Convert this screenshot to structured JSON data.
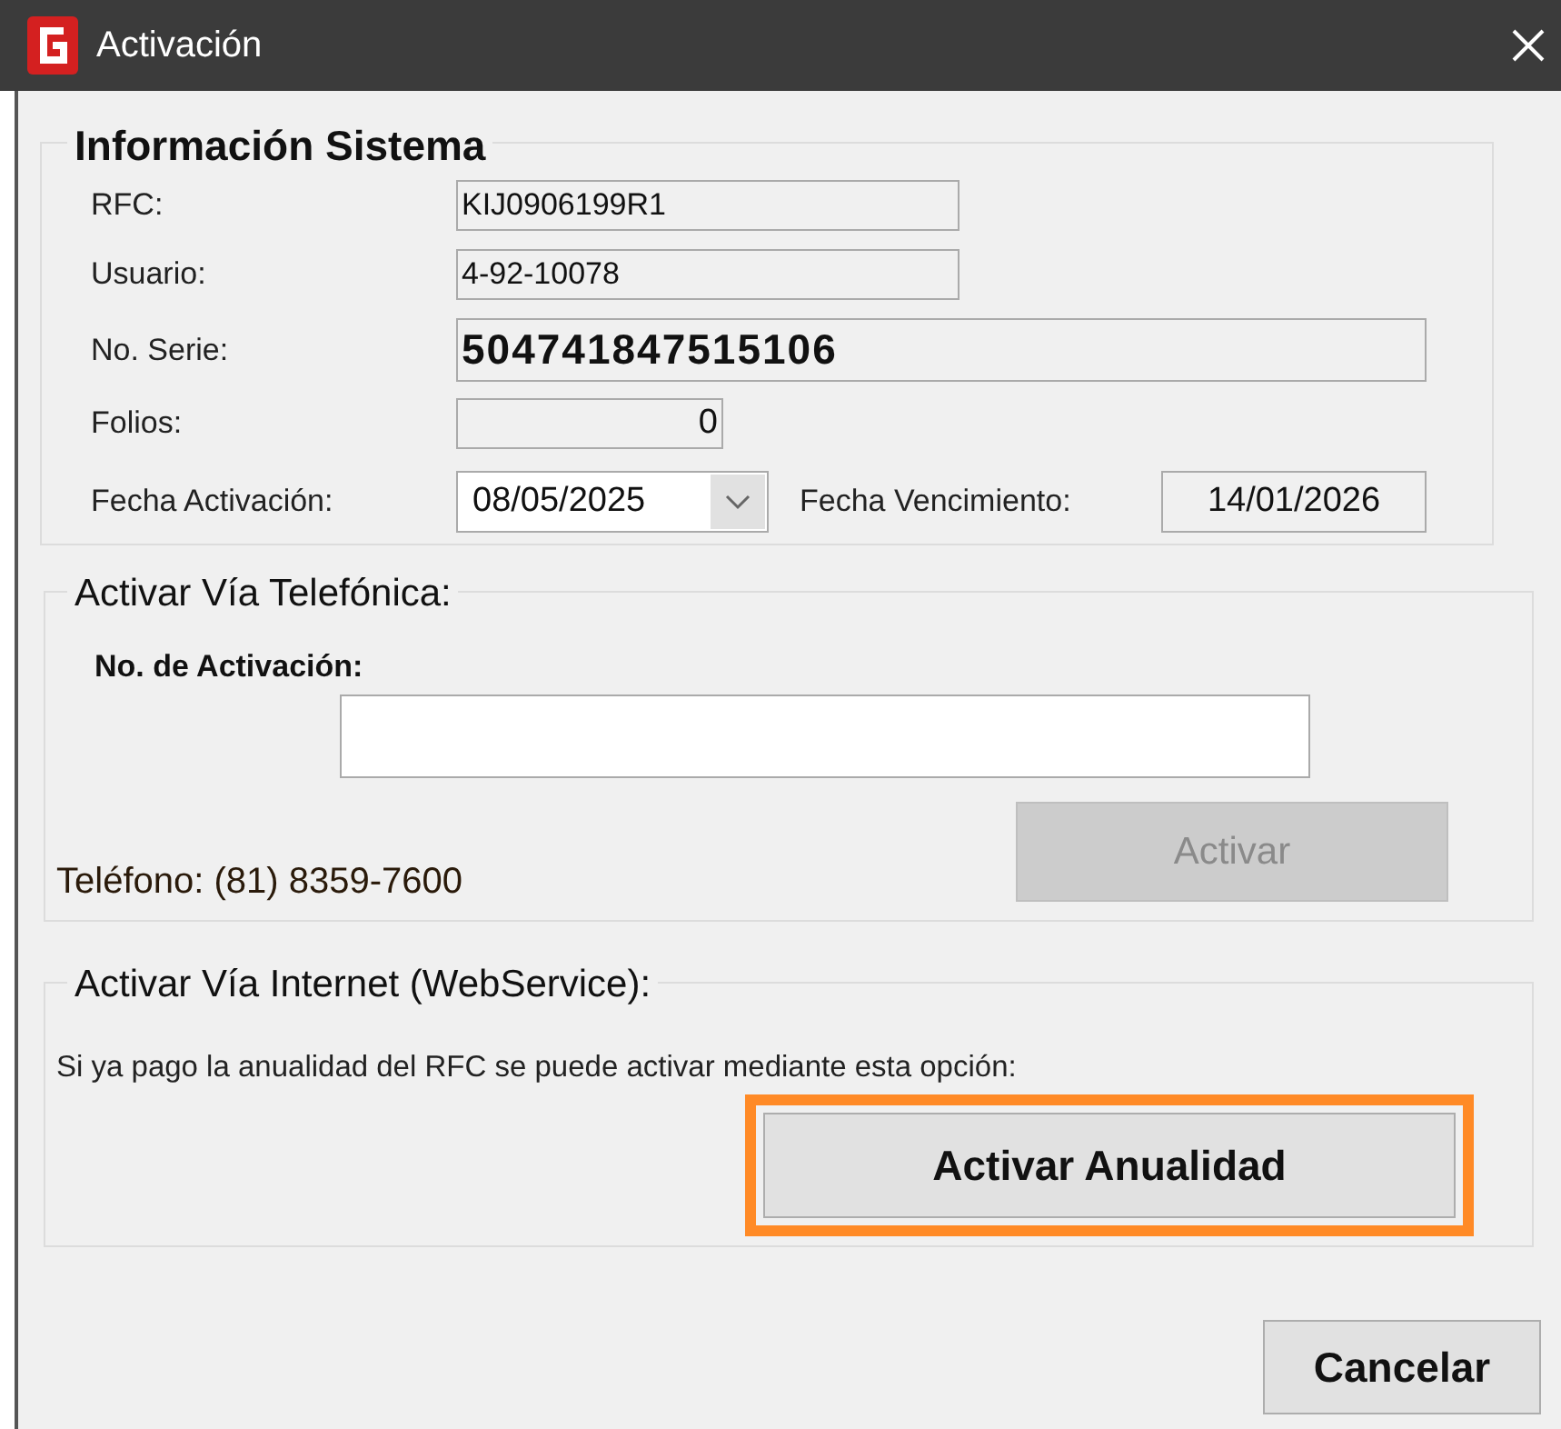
{
  "window": {
    "title": "Activación"
  },
  "system_info": {
    "title": "Información Sistema",
    "fields": [
      {
        "kind": "text",
        "label": "RFC:",
        "value": "KIJ0906199R1"
      },
      {
        "kind": "text",
        "label": "Usuario:",
        "value": "4-92-10078"
      },
      {
        "kind": "serial",
        "label": "No. Serie:",
        "value": "504741847515106"
      },
      {
        "kind": "number",
        "label": "Folios:",
        "value": "0"
      }
    ],
    "activation_date": {
      "label": "Fecha Activación:",
      "value": "08/05/2025"
    },
    "expiry_date": {
      "label": "Fecha Vencimiento:",
      "value": "14/01/2026"
    }
  },
  "phone_activation": {
    "title": "Activar Vía Telefónica:",
    "field_label": "No. de Activación:",
    "phone": "Teléfono: (81) 8359-7600",
    "button": {
      "label": "Activar",
      "disabled": true
    }
  },
  "internet_activation": {
    "title": "Activar Vía Internet (WebService):",
    "description": "Si ya pago la anualidad del RFC se puede activar mediante esta opción:",
    "button": {
      "label": "Activar Anualidad",
      "highlighted": true
    }
  },
  "buttons": [
    {
      "label": "Cancelar"
    }
  ]
}
